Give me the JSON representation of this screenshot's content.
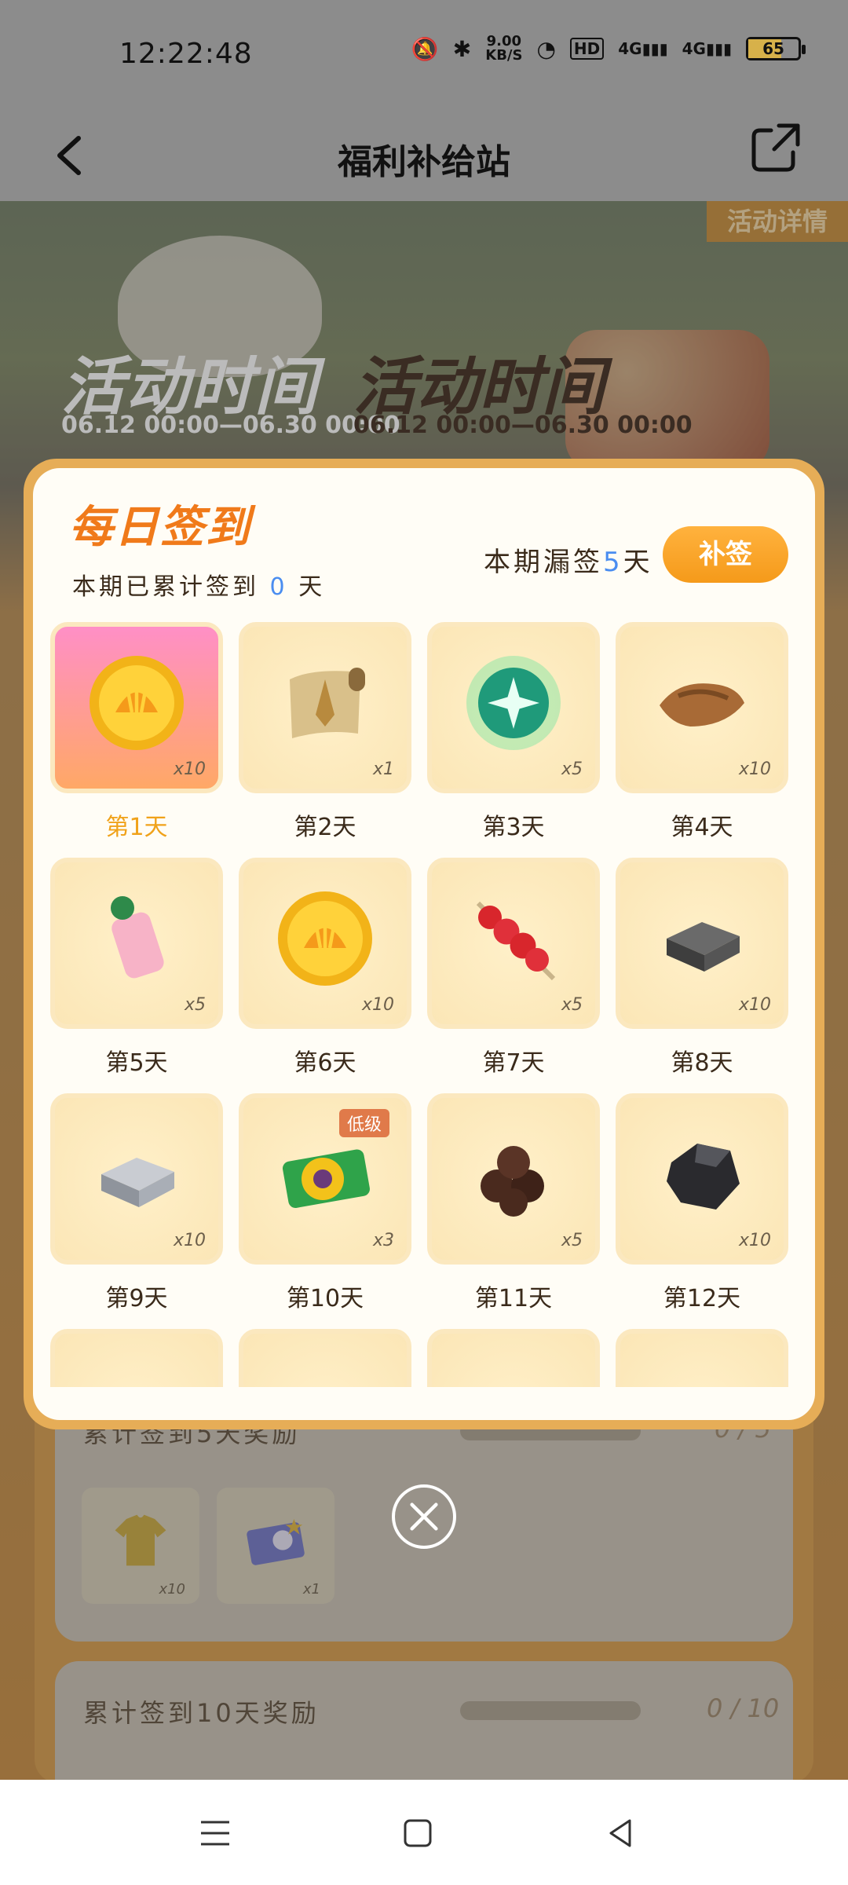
{
  "status_bar": {
    "time": "12:22:48",
    "net_speed_value": "9.00",
    "net_speed_unit": "KB/S",
    "hd_label": "HD",
    "signal1": "4G",
    "signal2": "4G",
    "battery": "65",
    "battery_level": 0.65
  },
  "nav": {
    "title": "福利补给站"
  },
  "banner": {
    "detail_tab": "活动详情",
    "title": "活动时间",
    "date": "06.12 00:00—06.30 00:00",
    "title_shadow": "活动时间",
    "date_shadow": "06.12 00:00—06.30 00:00"
  },
  "modal": {
    "title": "每日签到",
    "total_prefix": "本期已累计签到",
    "total_days": "0",
    "total_suffix": "天",
    "missed_prefix": "本期漏签",
    "missed_days": "5",
    "missed_suffix": "天",
    "makeup_button": "补签",
    "days": [
      {
        "label": "第1天",
        "qty": "x10",
        "icon": "shell-coin-icon",
        "active": true
      },
      {
        "label": "第2天",
        "qty": "x1",
        "icon": "scroll-icon"
      },
      {
        "label": "第3天",
        "qty": "x5",
        "icon": "green-orb-icon"
      },
      {
        "label": "第4天",
        "qty": "x10",
        "icon": "leather-icon"
      },
      {
        "label": "第5天",
        "qty": "x5",
        "icon": "pink-bottle-icon"
      },
      {
        "label": "第6天",
        "qty": "x10",
        "icon": "shell-coin-icon"
      },
      {
        "label": "第7天",
        "qty": "x5",
        "icon": "candied-haws-icon"
      },
      {
        "label": "第8天",
        "qty": "x10",
        "icon": "iron-ingot-icon"
      },
      {
        "label": "第9天",
        "qty": "x10",
        "icon": "silver-ingot-icon"
      },
      {
        "label": "第10天",
        "qty": "x3",
        "icon": "sunflower-ticket-icon",
        "badge": "低级"
      },
      {
        "label": "第11天",
        "qty": "x5",
        "icon": "chocolate-balls-icon"
      },
      {
        "label": "第12天",
        "qty": "x10",
        "icon": "coal-ore-icon"
      }
    ]
  },
  "behind": {
    "reward5_label": "累计签到5天奖励",
    "reward5_count": "0 / 5",
    "reward5_items": [
      {
        "qty": "x10",
        "icon": "yellow-shirt-icon"
      },
      {
        "qty": "x1",
        "icon": "unicorn-card-icon"
      }
    ],
    "reward10_label": "累计签到10天奖励",
    "reward10_count": "0 / 10"
  },
  "colors": {
    "accent_orange": "#f07a1a",
    "button_orange": "#f59a1a",
    "highlight_blue": "#4a8df0",
    "modal_border": "#e6ad57"
  }
}
